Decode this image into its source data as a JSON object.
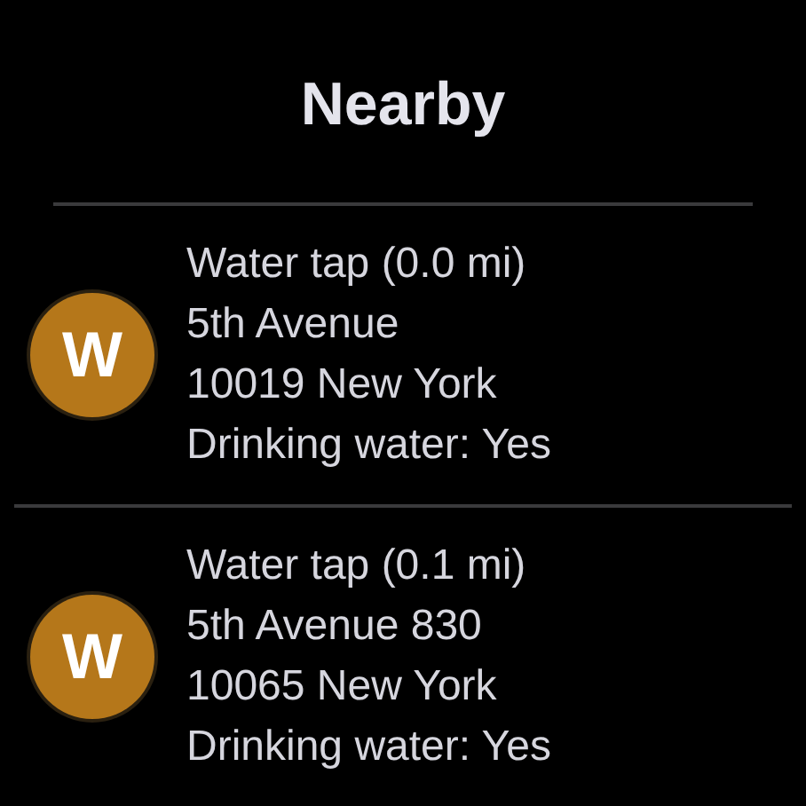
{
  "title": "Nearby",
  "items": [
    {
      "initial": "W",
      "color": "#b5771a",
      "lines": [
        "Water tap (0.0 mi)",
        "5th Avenue",
        "10019 New York",
        "Drinking water: Yes"
      ]
    },
    {
      "initial": "W",
      "color": "#b5771a",
      "lines": [
        "Water tap (0.1 mi)",
        "5th Avenue 830",
        "10065 New York",
        "Drinking water: Yes"
      ]
    }
  ]
}
